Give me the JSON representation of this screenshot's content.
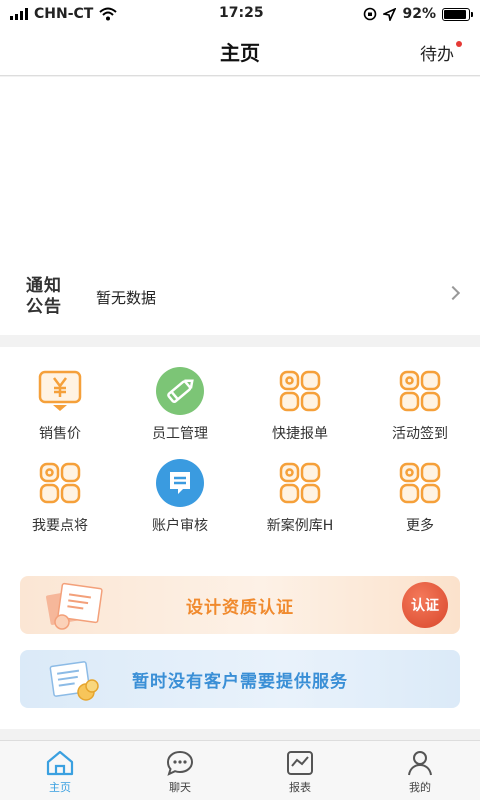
{
  "status_bar": {
    "carrier": "CHN-CT",
    "time": "17:25",
    "battery": "92%",
    "battery_level": 0.92
  },
  "header": {
    "title": "主页",
    "todo": "待办"
  },
  "notice": {
    "logo_line1": "通知",
    "logo_line2": "公告",
    "text": "暂无数据"
  },
  "menu": {
    "items": [
      {
        "label": "销售价",
        "icon": "yen-board-icon"
      },
      {
        "label": "员工管理",
        "icon": "pencil-circle-icon"
      },
      {
        "label": "快捷报单",
        "icon": "grid-placeholder-icon"
      },
      {
        "label": "活动签到",
        "icon": "grid-placeholder-icon"
      },
      {
        "label": "我要点将",
        "icon": "grid-placeholder-icon"
      },
      {
        "label": "账户审核",
        "icon": "chat-circle-icon"
      },
      {
        "label": "新案例库H",
        "icon": "grid-placeholder-icon"
      },
      {
        "label": "更多",
        "icon": "grid-placeholder-icon"
      }
    ]
  },
  "cards": {
    "design_text": "设计资质认证",
    "cert_button": "认证",
    "service_text": "暂时没有客户需要提供服务"
  },
  "tabs": [
    {
      "label": "主页",
      "icon": "home-icon",
      "active": true
    },
    {
      "label": "聊天",
      "icon": "chat-icon",
      "active": false
    },
    {
      "label": "报表",
      "icon": "report-icon",
      "active": false
    },
    {
      "label": "我的",
      "icon": "user-icon",
      "active": false
    }
  ],
  "colors": {
    "accent_orange": "#f5a03a",
    "tab_active": "#3aa0e0",
    "green": "#7cc576",
    "blue": "#3a9be0",
    "todo_dot": "#e53935"
  }
}
